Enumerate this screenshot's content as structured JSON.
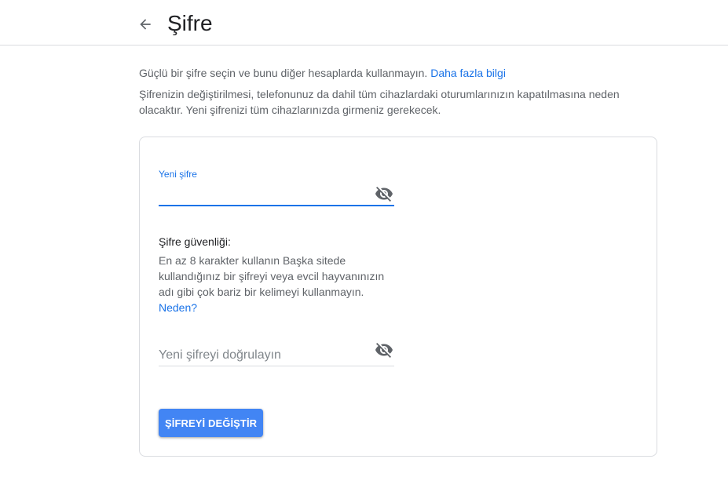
{
  "header": {
    "title": "Şifre"
  },
  "intro": {
    "line1": "Güçlü bir şifre seçin ve bunu diğer hesaplarda kullanmayın.",
    "learn_more": "Daha fazla bilgi",
    "line2": "Şifrenizin değiştirilmesi, telefonunuz da dahil tüm cihazlardaki oturumlarınızın kapatılmasına neden olacaktır. Yeni şifrenizi tüm cihazlarınızda girmeniz gerekecek."
  },
  "form": {
    "new_password": {
      "label": "Yeni şifre",
      "value": ""
    },
    "strength": {
      "title": "Şifre güvenliği:",
      "description": "En az 8 karakter kullanın Başka sitede kullandığınız bir şifreyi veya evcil hayvanınızın adı gibi çok bariz bir kelimeyi kullanmayın.",
      "why_link": "Neden?"
    },
    "confirm_password": {
      "placeholder": "Yeni şifreyi doğrulayın",
      "value": ""
    },
    "submit_label": "ŞİFREYİ DEĞİŞTİR"
  },
  "icons": {
    "back": "arrow-left-icon",
    "visibility": "eye-off-icon"
  },
  "colors": {
    "accent": "#1a73e8",
    "button": "#4285f4",
    "border": "#dadce0"
  }
}
